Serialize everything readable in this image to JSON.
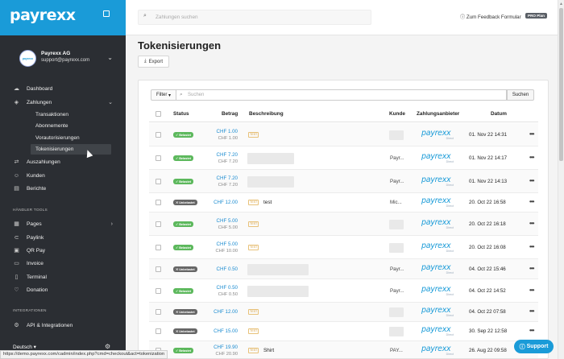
{
  "brand": {
    "logo": "payrexx",
    "accent": "#1a9bd8"
  },
  "account": {
    "avatar_text": "payrexx",
    "name": "Payrexx AG",
    "email": "support@payrexx.com"
  },
  "sidebar": {
    "items": [
      {
        "label": "Dashboard",
        "icon": "cloud-icon"
      },
      {
        "label": "Zahlungen",
        "icon": "tag-icon"
      },
      {
        "label": "Auszahlungen",
        "icon": "transfer-icon"
      },
      {
        "label": "Kunden",
        "icon": "user-icon"
      },
      {
        "label": "Berichte",
        "icon": "report-icon"
      }
    ],
    "sub_items": [
      "Transaktionen",
      "Abonnemente",
      "Vorautorisierungen",
      "Tokenisierungen"
    ],
    "section_tools": "HÄNDLER TOOLS",
    "tools": [
      {
        "label": "Pages",
        "icon": "pages-icon"
      },
      {
        "label": "Paylink",
        "icon": "link-icon"
      },
      {
        "label": "QR Pay",
        "icon": "qr-icon"
      },
      {
        "label": "Invoice",
        "icon": "invoice-icon"
      },
      {
        "label": "Terminal",
        "icon": "terminal-icon"
      },
      {
        "label": "Donation",
        "icon": "heart-icon"
      }
    ],
    "section_integrations": "INTEGRATIONEN",
    "integrations": [
      {
        "label": "API & Integrationen",
        "icon": "plug-icon"
      }
    ],
    "language": "Deutsch"
  },
  "topbar": {
    "search_placeholder": "Zahlungen suchen",
    "feedback": "Zum Feedback Formular",
    "plan": "PRO Plan"
  },
  "page": {
    "title": "Tokenisierungen",
    "export_label": "Export"
  },
  "filter": {
    "button": "Filter",
    "placeholder": "Suchen",
    "search_button": "Suchen"
  },
  "table": {
    "headers": {
      "status": "Status",
      "amount": "Betrag",
      "description": "Beschreibung",
      "customer": "Kunde",
      "provider": "Zahlungsanbieter",
      "date": "Datum"
    },
    "provider_name": "payrexx",
    "provider_sub": "Direct",
    "test_label": "TEST",
    "rows": [
      {
        "status": "Belastet",
        "ok": true,
        "amount": "CHF 1.00",
        "amount2": "CHF 1.00",
        "test": true,
        "desc": "",
        "blur_desc": false,
        "kunde": "",
        "blur_kunde": true,
        "date": "01. Nov 22 14:31"
      },
      {
        "status": "Belastet",
        "ok": true,
        "amount": "CHF 7.20",
        "amount2": "CHF 7.20",
        "test": false,
        "desc": "",
        "blur_desc": true,
        "kunde": "Payr...",
        "blur_kunde": false,
        "date": "01. Nov 22 14:17"
      },
      {
        "status": "Belastet",
        "ok": true,
        "amount": "CHF 7.20",
        "amount2": "CHF 7.20",
        "test": false,
        "desc": "",
        "blur_desc": true,
        "kunde": "Payr...",
        "blur_kunde": false,
        "date": "01. Nov 22 14:13"
      },
      {
        "status": "Unbelastet",
        "ok": false,
        "amount": "CHF 12.00",
        "amount2": "",
        "test": true,
        "desc": "test",
        "blur_desc": false,
        "kunde": "Mic...",
        "blur_kunde": false,
        "date": "20. Oct 22 16:58"
      },
      {
        "status": "Belastet",
        "ok": true,
        "amount": "CHF 5.00",
        "amount2": "CHF 5.00",
        "test": true,
        "desc": "",
        "blur_desc": false,
        "kunde": "",
        "blur_kunde": true,
        "date": "20. Oct 22 16:18"
      },
      {
        "status": "Belastet",
        "ok": true,
        "amount": "CHF 5.00",
        "amount2": "CHF 10.00",
        "test": true,
        "desc": "",
        "blur_desc": false,
        "kunde": "",
        "blur_kunde": true,
        "date": "20. Oct 22 16:08"
      },
      {
        "status": "Unbelastet",
        "ok": false,
        "amount": "CHF 0.50",
        "amount2": "",
        "test": false,
        "desc": "",
        "blur_desc": true,
        "kunde": "Payr...",
        "blur_kunde": false,
        "date": "04. Oct 22 15:46"
      },
      {
        "status": "Belastet",
        "ok": true,
        "amount": "CHF 0.50",
        "amount2": "CHF 0.50",
        "test": false,
        "desc": "",
        "blur_desc": true,
        "kunde": "Payr...",
        "blur_kunde": false,
        "date": "04. Oct 22 14:52"
      },
      {
        "status": "Unbelastet",
        "ok": false,
        "amount": "CHF 12.00",
        "amount2": "",
        "test": true,
        "desc": "",
        "blur_desc": false,
        "kunde": "",
        "blur_kunde": true,
        "date": "04. Oct 22 07:58"
      },
      {
        "status": "Unbelastet",
        "ok": false,
        "amount": "CHF 15.00",
        "amount2": "",
        "test": true,
        "desc": "",
        "blur_desc": false,
        "kunde": "",
        "blur_kunde": true,
        "date": "30. Sep 22 12:58"
      },
      {
        "status": "Belastet",
        "ok": true,
        "amount": "CHF 19.90",
        "amount2": "CHF 20.90",
        "test": true,
        "desc": "Shirt",
        "blur_desc": false,
        "kunde": "PAY...",
        "blur_kunde": false,
        "date": "26. Aug 22 09:58"
      }
    ]
  },
  "status_url": "https://demo.payrexx.com/cadmin/index.php?cmd=checkout&act=tokenization",
  "support_label": "Support"
}
